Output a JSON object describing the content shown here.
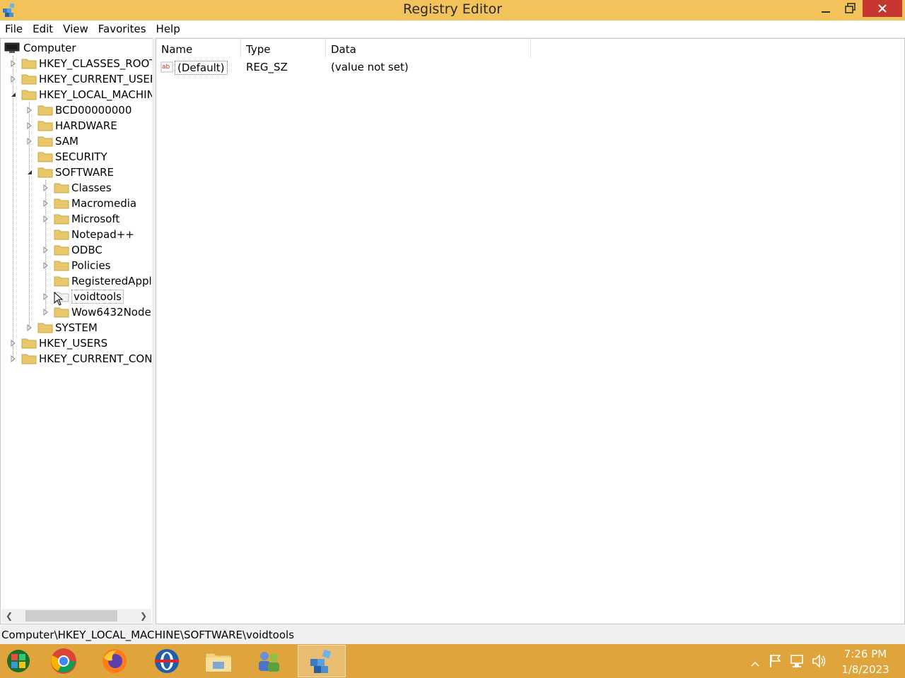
{
  "window": {
    "title": "Registry Editor"
  },
  "menu": {
    "items": [
      "File",
      "Edit",
      "View",
      "Favorites",
      "Help"
    ]
  },
  "tree": {
    "root": "Computer",
    "hives": {
      "classes_root": "HKEY_CLASSES_ROOT",
      "current_user": "HKEY_CURRENT_USER",
      "local_machine": "HKEY_LOCAL_MACHINE",
      "users": "HKEY_USERS",
      "current_config": "HKEY_CURRENT_CONFIG"
    },
    "hklm_children": [
      "BCD00000000",
      "HARDWARE",
      "SAM",
      "SECURITY",
      "SOFTWARE",
      "SYSTEM"
    ],
    "software_children": [
      "Classes",
      "Macromedia",
      "Microsoft",
      "Notepad++",
      "ODBC",
      "Policies",
      "RegisteredApplications",
      "voidtools",
      "Wow6432Node"
    ],
    "selected": "voidtools"
  },
  "list": {
    "columns": [
      "Name",
      "Type",
      "Data"
    ],
    "rows": [
      {
        "name": "(Default)",
        "type": "REG_SZ",
        "data": "(value not set)",
        "icon": "string-value-icon"
      }
    ]
  },
  "status": {
    "path": "Computer\\HKEY_LOCAL_MACHINE\\SOFTWARE\\voidtools"
  },
  "taskbar": {
    "apps": [
      "windows-media-center-icon",
      "chrome-icon",
      "firefox-icon",
      "opera-icon",
      "file-explorer-icon",
      "user-accounts-icon",
      "registry-editor-icon"
    ],
    "active_app": "registry-editor-icon",
    "clock": {
      "time": "7:26 PM",
      "date": "1/8/2023"
    }
  },
  "colors": {
    "titlebar": "#f3c35b",
    "taskbar": "#e0a43c",
    "close_button": "#c7372f",
    "folder": "#e8c86a"
  }
}
